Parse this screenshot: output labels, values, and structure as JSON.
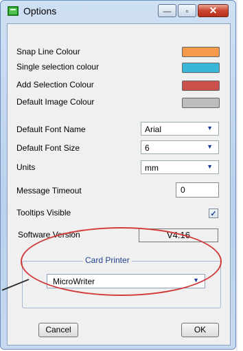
{
  "window": {
    "title": "Options",
    "controls": {
      "minimize": "—",
      "maximize": "▫",
      "close": "✕"
    }
  },
  "colours": [
    {
      "label": "Snap Line Colour",
      "color": "#f59a4a"
    },
    {
      "label": "Single selection colour",
      "color": "#38b8d6"
    },
    {
      "label": "Add Selection Colour",
      "color": "#c9504b"
    },
    {
      "label": "Default Image Colour",
      "color": "#bdbdbd"
    }
  ],
  "font": {
    "name_label": "Default Font Name",
    "name_value": "Arial",
    "size_label": "Default Font Size",
    "size_value": "6"
  },
  "units": {
    "label": "Units",
    "value": "mm"
  },
  "timeout": {
    "label": "Message Timeout",
    "value": "0"
  },
  "tooltips": {
    "label": "Tooltips Visible",
    "checked": true,
    "mark": "✓"
  },
  "version": {
    "label": "Software Version",
    "value": "V4.16"
  },
  "card_printer": {
    "legend": "Card Printer",
    "value": "MicroWriter"
  },
  "buttons": {
    "cancel": "Cancel",
    "ok": "OK"
  }
}
